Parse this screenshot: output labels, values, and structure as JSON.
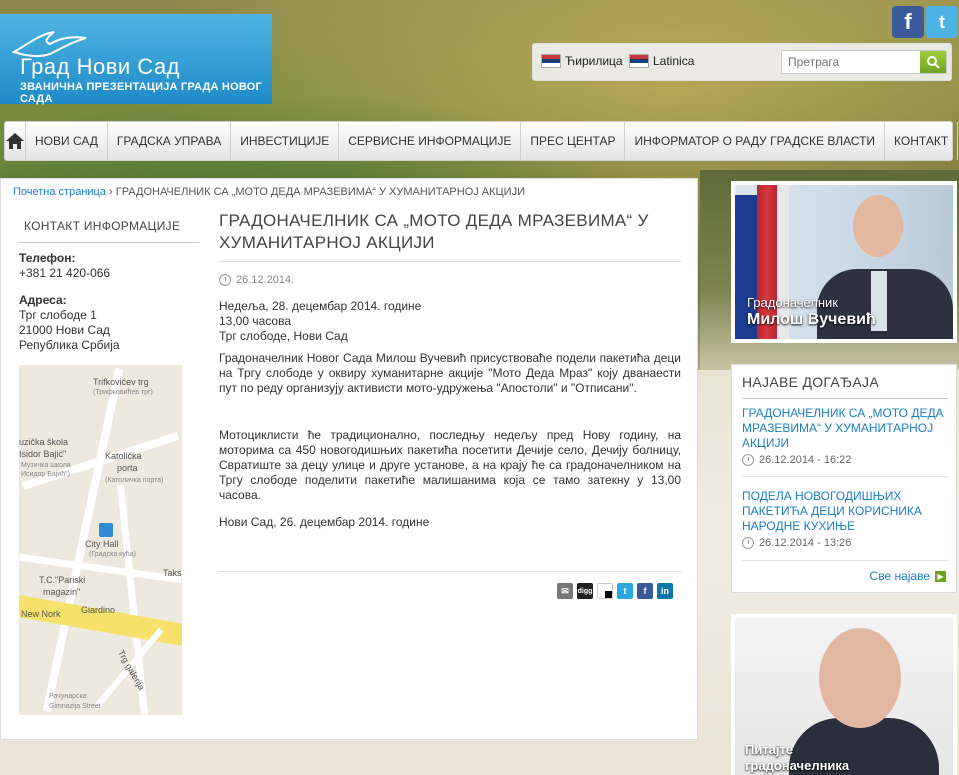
{
  "header": {
    "logo_title": "Град Нови Сад",
    "logo_subtitle": "ЗВАНИЧНА ПРЕЗЕНТАЦИЈА ГРАДА НОВОГ САДА",
    "lang_cyrillic": "Ћирилица",
    "lang_latin": "Latinica",
    "search_placeholder": "Претрага"
  },
  "nav": {
    "items": [
      "НОВИ САД",
      "ГРАДСКА УПРАВА",
      "ИНВЕСТИЦИЈЕ",
      "СЕРВИСНЕ ИНФОРМАЦИЈЕ",
      "ПРЕС ЦЕНТАР",
      "ИНФОРМАТОР О РАДУ ГРАДСКЕ ВЛАСТИ",
      "КОНТАКТ"
    ]
  },
  "breadcrumb": {
    "home": "Почетна страница",
    "current": " › ГРАДОНАЧЕЛНИК СА „МОТО ДЕДА МРАЗЕВИМА“ У ХУМАНИТАРНОЈ АКЦИЈИ"
  },
  "contact": {
    "heading": "КОНТАКТ ИНФОРМАЦИЈЕ",
    "phone_label": "Телефон:",
    "phone": "+381 21 420-066",
    "address_label": "Адреса:",
    "address_line1": "Трг слободе 1",
    "address_line2": "21000 Нови Сад",
    "address_line3": "Република Србија"
  },
  "map": {
    "labels": [
      "Trifkovićev trg",
      "(Трифковићев трг)",
      "uzička škola",
      "Isidor Bajić\"",
      "Музичка школа",
      "Исидор Бајић\")",
      "Katolička",
      "porta",
      "(Католичка порта)",
      "City Hall",
      "(Градска кућа)",
      "T.C.\"Pariski",
      "magazin\"",
      "Taks",
      "New Nork",
      "Giardino",
      "Trg galerija",
      "Рачунарска",
      "Gimnazija Street"
    ]
  },
  "article": {
    "title": "ГРАДОНАЧЕЛНИК СА „МОТО ДЕДА МРАЗЕВИМА“ У ХУМАНИТАРНОЈ АКЦИЈИ",
    "date": "26.12.2014.",
    "event_info": [
      "Недеља, 28. децембар 2014. године",
      "13,00 часова",
      "Трг слободе, Нови Сад"
    ],
    "paragraph1": "Градоначелник Новог Сада Милош Вучевић присуствоваће подели пакетића деци на Тргу слободе у оквиру хуманитарне акције \"Мото Деда Мраз\" коју дванаести пут по реду организују активисти мото-удружења \"Апостоли\" и \"Отписани\".",
    "paragraph2": "Мотоциклисти ће традиционално, последњу недељу пред Нову годину, на моторима са 450 новогодишњих пакетића посетити Дечије село, Дечију болницу, Свратиште за децу улице и друге установе, а на крају ће са градоначелником на Тргу слободе поделити пакетиће малишанима која се тамо затекну у 13,00 часова.",
    "signature": "Нови Сад, 26. децембар 2014. године"
  },
  "sidebar": {
    "mayor_role": "Градоначелник",
    "mayor_name": "Милош Вучевић",
    "events_heading": "НАЈАВЕ ДОГАЂАЈА",
    "events": [
      {
        "title": "ГРАДОНАЧЕЛНИК СА „МОТО ДЕДА МРАЗЕВИМА“ У ХУМАНИТАРНОЈ АКЦИЈИ",
        "date": "26.12.2014 - 16:22"
      },
      {
        "title": "ПОДЕЛА НОВОГОДИШЊИХ ПАКЕТИЋА ДЕЦИ КОРИСНИКА НАРОДНЕ КУХИЊЕ",
        "date": "26.12.2014 - 13:26"
      }
    ],
    "all_events": "Све најаве",
    "ask_line1": "Питајте",
    "ask_line2": "градоначелника"
  },
  "colors": {
    "accent_blue": "#1a7fc1",
    "logo_blue": "#1e8bc8",
    "search_green": "#6ea321"
  }
}
